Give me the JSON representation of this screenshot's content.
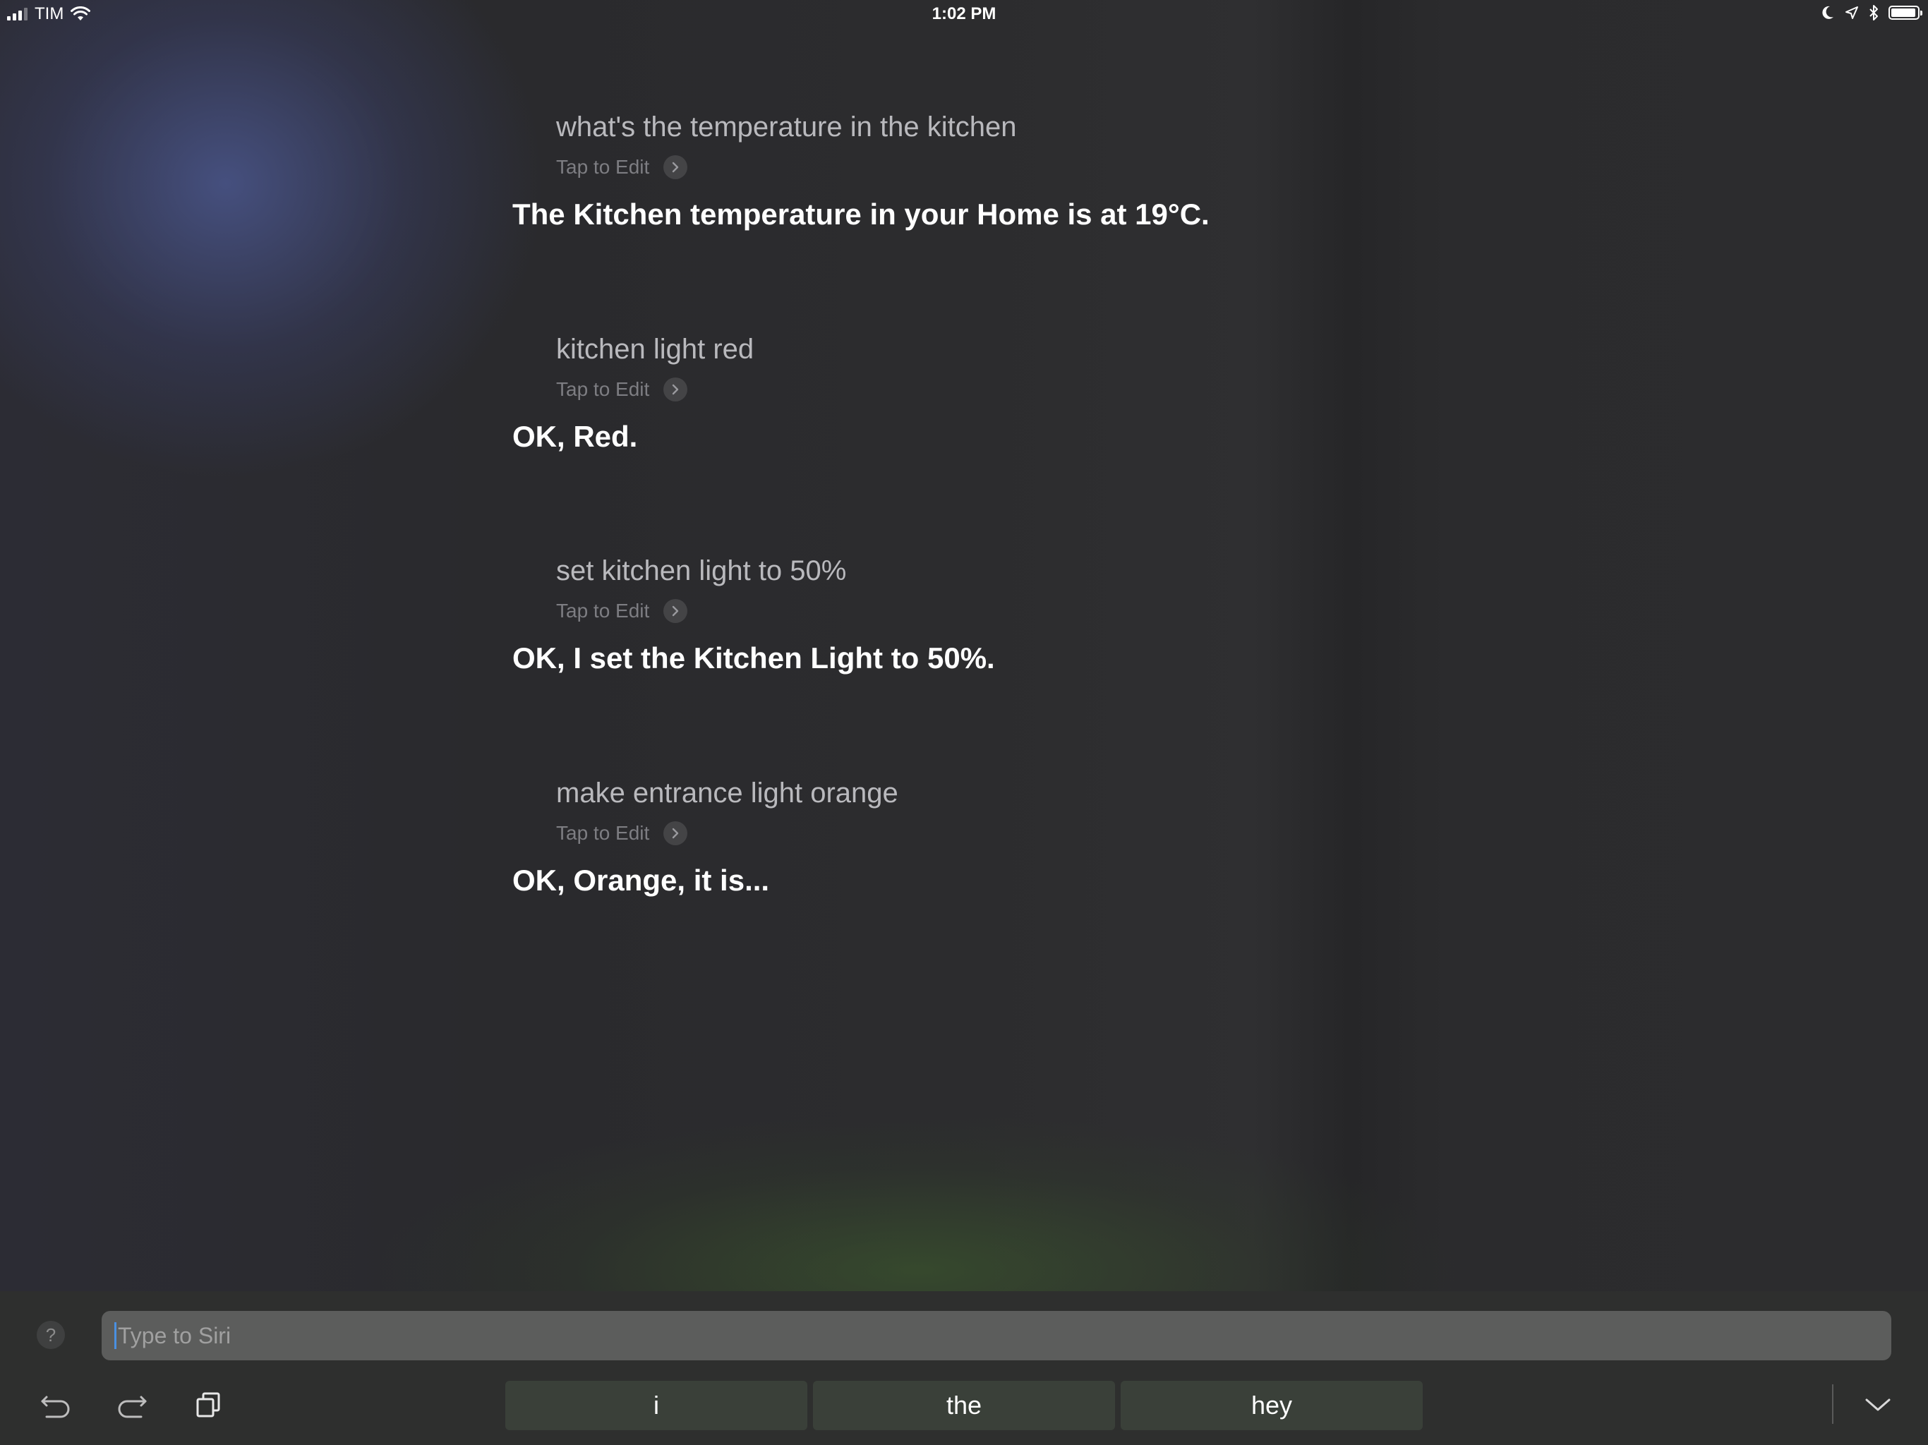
{
  "status_bar": {
    "carrier": "TIM",
    "time": "1:02 PM",
    "battery_level": 0.95,
    "icons": [
      "signal-icon",
      "wifi-icon",
      "moon-icon",
      "location-icon",
      "bluetooth-icon",
      "battery-icon"
    ]
  },
  "exchanges": [
    {
      "query": "what's the temperature in the kitchen",
      "edit_label": "Tap to Edit",
      "response": "The Kitchen temperature in your Home is at 19°C."
    },
    {
      "query": "kitchen light red",
      "edit_label": "Tap to Edit",
      "response": "OK, Red."
    },
    {
      "query": "set kitchen light to 50%",
      "edit_label": "Tap to Edit",
      "response": "OK, I set the Kitchen Light to 50%."
    },
    {
      "query": "make entrance light orange",
      "edit_label": "Tap to Edit",
      "response": "OK, Orange, it is..."
    }
  ],
  "input": {
    "help_label": "?",
    "placeholder": "Type to Siri",
    "value": ""
  },
  "suggestions": [
    "i",
    "the",
    "hey"
  ],
  "colors": {
    "field": "#5c5d5c",
    "suggestion_bg": "#3a4039",
    "cursor": "#4a90e2"
  }
}
